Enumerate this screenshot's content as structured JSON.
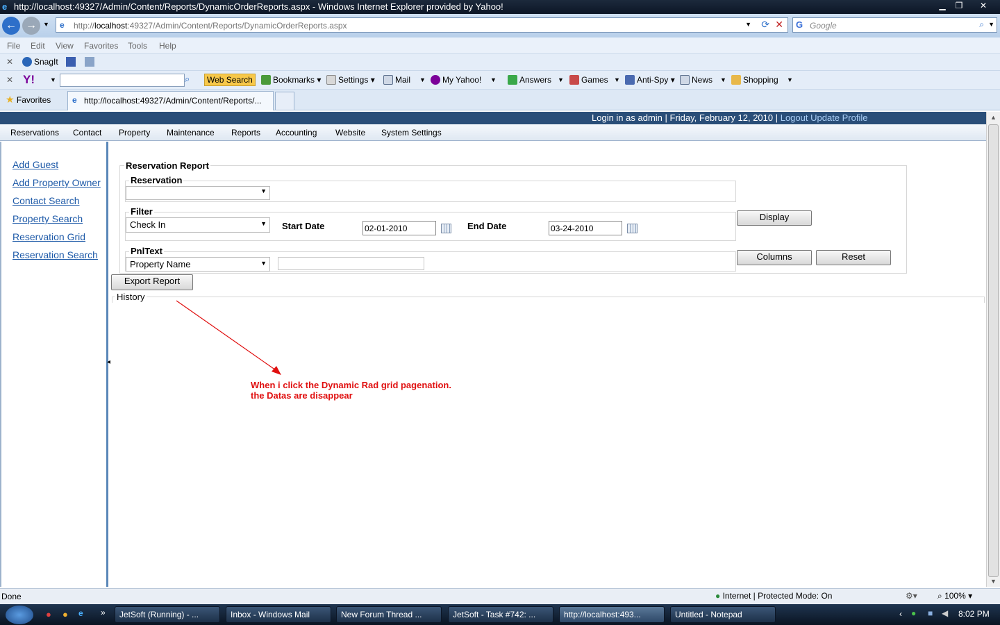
{
  "window": {
    "title": "http://localhost:49327/Admin/Content/Reports/DynamicOrderReports.aspx - Windows Internet Explorer provided by Yahoo!"
  },
  "address": {
    "url_prefix": "http://",
    "url_host": "localhost",
    "url_rest": ":49327/Admin/Content/Reports/DynamicOrderReports.aspx",
    "search_placeholder": "Google"
  },
  "menu": [
    "File",
    "Edit",
    "View",
    "Favorites",
    "Tools",
    "Help"
  ],
  "snagit": {
    "label": "SnagIt"
  },
  "yahoo_toolbar": {
    "web_search": "Web Search",
    "bookmarks": "Bookmarks",
    "settings": "Settings",
    "mail": "Mail",
    "my_yahoo": "My Yahoo!",
    "answers": "Answers",
    "games": "Games",
    "anti_spy": "Anti-Spy",
    "news": "News",
    "shopping": "Shopping"
  },
  "tabs": {
    "favorites": "Favorites",
    "active_tab": "http://localhost:49327/Admin/Content/Reports/..."
  },
  "header": {
    "login_text": "Login in as  admin | Friday, February 12, 2010 | ",
    "logout": "Logout",
    "update_profile": "Update Profile"
  },
  "nav": [
    "Reservations",
    "Contact",
    "Property",
    "Maintenance",
    "Reports",
    "Accounting",
    "Website",
    "System Settings"
  ],
  "sidebar": [
    "Add Guest",
    "Add Property Owner",
    "Contact Search",
    "Property Search",
    "Reservation Grid",
    "Reservation Search"
  ],
  "report": {
    "title": "Reservation Report",
    "reservation_legend": "Reservation",
    "reservation_value": "",
    "filter_legend": "Filter",
    "filter_value": "Check In",
    "start_date_label": "Start Date",
    "start_date": "02-01-2010",
    "end_date_label": "End Date",
    "end_date": "03-24-2010",
    "display_button": "Display",
    "pnl_legend": "PnlText",
    "pnl_value": "Property Name",
    "pnl_text": "",
    "columns_button": "Columns",
    "reset_button": "Reset",
    "export_button": "Export Report",
    "history": "History"
  },
  "annotation": {
    "line1": "When i click the Dynamic Rad grid pagenation.",
    "line2": "the Datas are disappear",
    "color": "#e01010"
  },
  "status": {
    "left": "Done",
    "zone": "Internet | Protected Mode: On",
    "zoom": "100%"
  },
  "taskbar": {
    "items": [
      "JetSoft (Running) - ...",
      "Inbox - Windows Mail",
      "New Forum Thread ...",
      "JetSoft - Task #742: ...",
      "http://localhost:493...",
      "Untitled - Notepad"
    ],
    "time": "8:02 PM"
  }
}
